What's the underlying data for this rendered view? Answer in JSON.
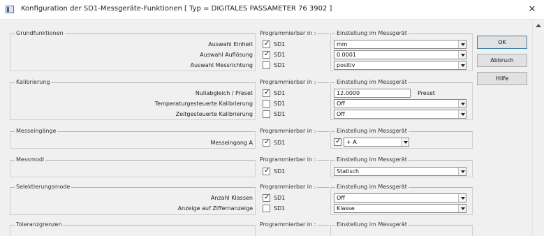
{
  "window": {
    "title": "Konfiguration der SD1-Messgeräte-Funktionen   [ Typ = DIGITALES PASSAMETER 76 3902 ]",
    "close_glyph": "✕",
    "icon": "window-app-icon"
  },
  "columns": {
    "programmierbar": "Programmierbar in :",
    "einstellung": "Einstellung im Messgerät"
  },
  "buttons": {
    "ok": "OK",
    "abbruch": "Abbruch",
    "hilfe": "Hilfe"
  },
  "sections": {
    "grundfunktionen": {
      "title": "Grundfunktionen",
      "rows": [
        {
          "label": "Auswahl Einheit",
          "sd1": "SD1",
          "checked": true,
          "value": "mm"
        },
        {
          "label": "Auswahl Auflösung",
          "sd1": "SD1",
          "checked": true,
          "value": "0.0001"
        },
        {
          "label": "Auswahl Messrichtung",
          "sd1": "SD1",
          "checked": false,
          "value": "positiv"
        }
      ]
    },
    "kalibrierung": {
      "title": "Kalibrierung",
      "rows": [
        {
          "label": "Nullabgleich / Preset",
          "sd1": "SD1",
          "checked": true,
          "value": "12.0000",
          "suffix": "Preset"
        },
        {
          "label": "Temperaturgesteuerte Kalibrierung",
          "sd1": "SD1",
          "checked": false,
          "value": "Off"
        },
        {
          "label": "Zeitgesteuerte Kalibrierung",
          "sd1": "SD1",
          "checked": false,
          "value": "Off"
        }
      ]
    },
    "messeingaenge": {
      "title": "Messeingänge",
      "rows": [
        {
          "label": "Messeingang A",
          "sd1": "SD1",
          "checked": true,
          "value": "+ A",
          "enabled": true
        }
      ]
    },
    "messmodi": {
      "title": "Messmodi",
      "rows": [
        {
          "label": "",
          "sd1": "SD1",
          "checked": true,
          "value": "Statisch"
        }
      ]
    },
    "selektierungsmode": {
      "title": "Selektierungsmode",
      "rows": [
        {
          "label": "Anzahl Klassen",
          "sd1": "SD1",
          "checked": true,
          "value": "Off"
        },
        {
          "label": "Anzeige auf Ziffernanzeige",
          "sd1": "SD1",
          "checked": false,
          "value": "Klasse"
        }
      ]
    },
    "toleranzgrenzen": {
      "title": "Toleranzgrenzen"
    }
  },
  "colors": {
    "dialog_bg": "#f0f0f0",
    "default_button_border": "#3c7fb1"
  }
}
